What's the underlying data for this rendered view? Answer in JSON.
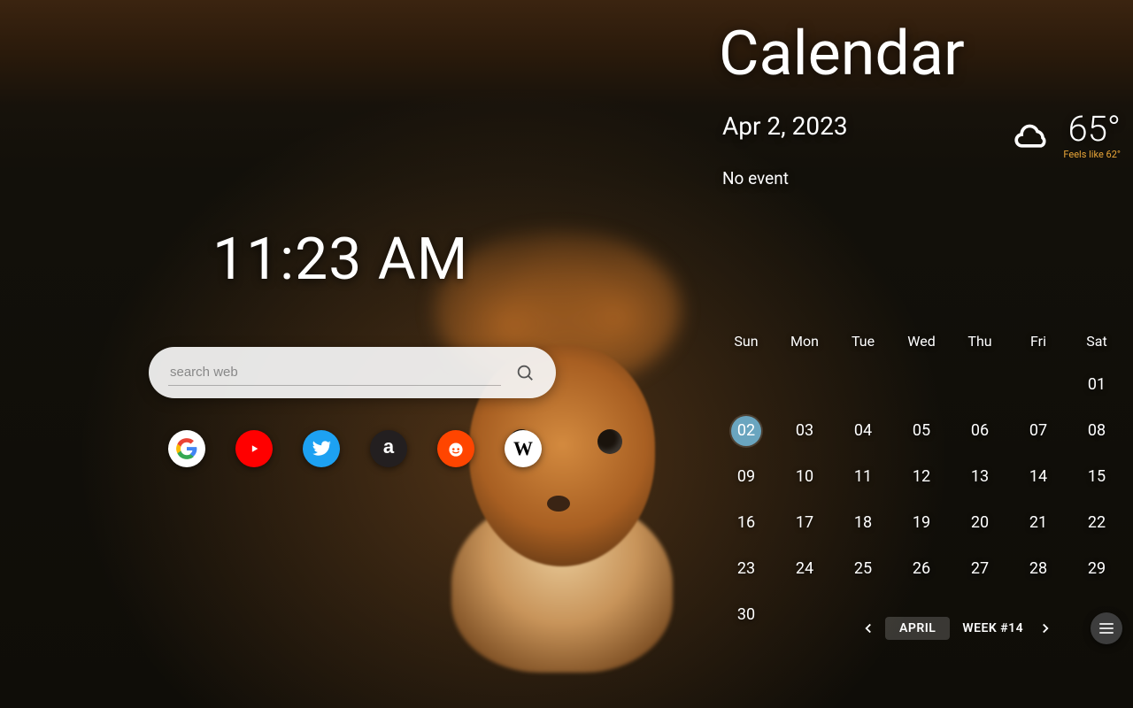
{
  "clock": {
    "time": "11:23 AM"
  },
  "search": {
    "placeholder": "search web"
  },
  "shortcuts": [
    {
      "name": "google"
    },
    {
      "name": "youtube"
    },
    {
      "name": "twitter"
    },
    {
      "name": "amazon"
    },
    {
      "name": "reddit"
    },
    {
      "name": "wikipedia"
    }
  ],
  "calendar": {
    "title": "Calendar",
    "date": "Apr 2, 2023",
    "event_text": "No event",
    "weather": {
      "temp": "65°",
      "feels_like": "Feels like 62°",
      "condition": "cloudy"
    },
    "day_headers": [
      "Sun",
      "Mon",
      "Tue",
      "Wed",
      "Thu",
      "Fri",
      "Sat"
    ],
    "leading_blanks": 6,
    "days_in_month": 30,
    "today": 2,
    "month_label": "APRIL",
    "week_label": "WEEK #14"
  }
}
